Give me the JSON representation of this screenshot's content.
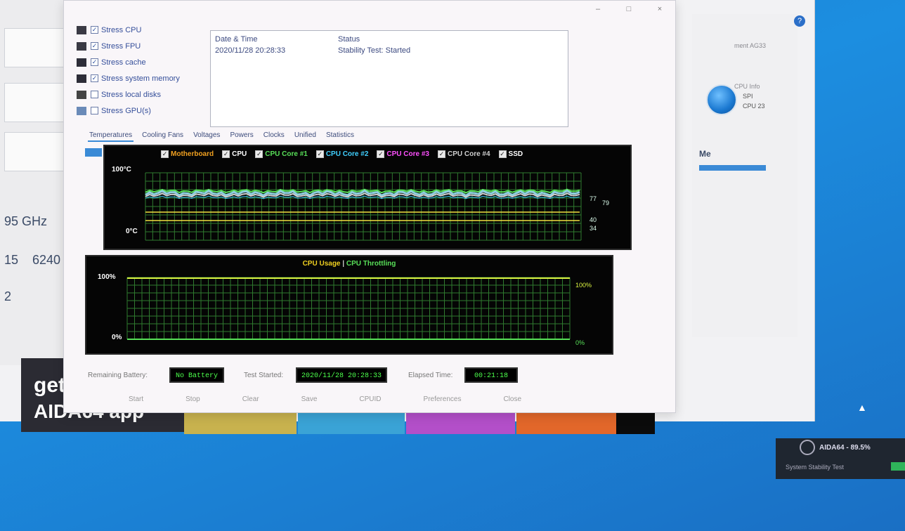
{
  "background": {
    "left_metrics": [
      "95 GHz",
      "15",
      "6240",
      "2"
    ],
    "right_text_1": "ment AG33",
    "right_text_2": "CPU Info",
    "gauge_label_1": "SPI",
    "gauge_label_2": "CPU 23",
    "right_label": "Me",
    "help_icon": "help-icon"
  },
  "banner": {
    "line1": "get",
    "line2": "AIDA64 app"
  },
  "dialog": {
    "title_buttons": [
      "–",
      "□",
      "×"
    ],
    "stress_items": [
      {
        "label": "Stress CPU",
        "checked": true,
        "icon": "cpu-icon"
      },
      {
        "label": "Stress FPU",
        "checked": true,
        "icon": "fpu-icon"
      },
      {
        "label": "Stress cache",
        "checked": true,
        "icon": "cache-icon"
      },
      {
        "label": "Stress system memory",
        "checked": true,
        "icon": "memory-icon"
      },
      {
        "label": "Stress local disks",
        "checked": false,
        "icon": "disk-icon"
      },
      {
        "label": "Stress GPU(s)",
        "checked": false,
        "icon": "gpu-icon"
      }
    ],
    "log": {
      "header_datetime": "Date & Time",
      "header_status": "Status",
      "rows": [
        {
          "datetime": "2020/11/28 20:28:33",
          "status": "Stability Test: Started"
        }
      ]
    },
    "tabs": [
      "Temperatures",
      "Cooling Fans",
      "Voltages",
      "Powers",
      "Clocks",
      "Unified",
      "Statistics"
    ],
    "temp_chart": {
      "legend": [
        {
          "label": "Motherboard",
          "color": "#f0a020"
        },
        {
          "label": "CPU",
          "color": "#ffffff"
        },
        {
          "label": "CPU Core #1",
          "color": "#58e058"
        },
        {
          "label": "CPU Core #2",
          "color": "#40d0ff"
        },
        {
          "label": "CPU Core #3",
          "color": "#ff50ff"
        },
        {
          "label": "CPU Core #4",
          "color": "#cfcfcf"
        },
        {
          "label": "SSD",
          "color": "#ffffff"
        }
      ],
      "y_top": "100°C",
      "y_bottom": "0°C",
      "right_values": [
        "77",
        "79",
        "40",
        "34"
      ]
    },
    "usage_chart": {
      "title_a": "CPU Usage",
      "title_sep": "|",
      "title_b": "CPU Throttling",
      "title_a_color": "#f0d020",
      "title_b_color": "#58e058",
      "y_top": "100%",
      "y_bottom": "0%",
      "right_top": "100%",
      "right_bottom": "0%"
    },
    "status": {
      "remaining_label": "Remaining Battery:",
      "remaining_value": "No Battery",
      "test_started_label": "Test Started:",
      "test_started_value": "2020/11/28 20:28:33",
      "elapsed_label": "Elapsed Time:",
      "elapsed_value": "00:21:18"
    },
    "buttons": [
      "Start",
      "Stop",
      "Clear",
      "Save",
      "CPUID",
      "Preferences",
      "Close"
    ]
  },
  "tray": {
    "title": "AIDA64 - 89.5%",
    "subtitle": "System Stability Test"
  }
}
